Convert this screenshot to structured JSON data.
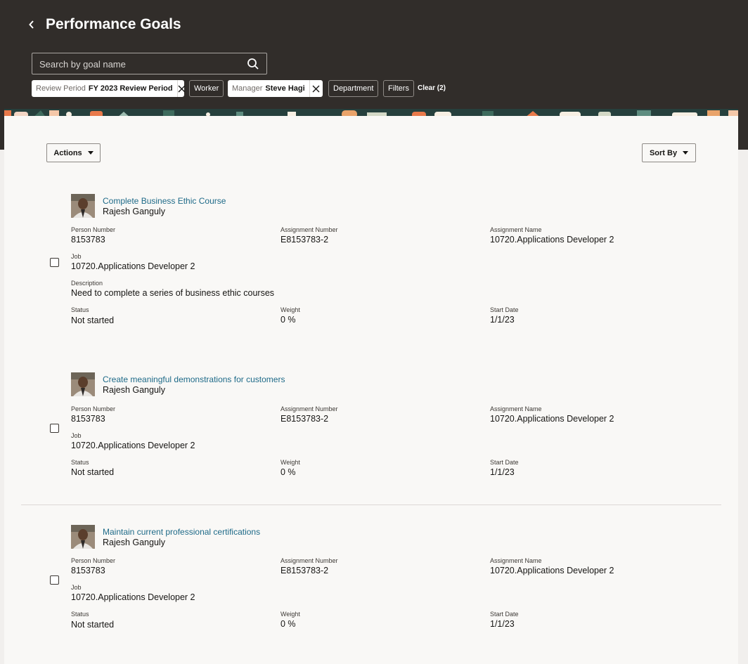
{
  "header": {
    "title": "Performance Goals",
    "back_icon": "chevron-left-icon"
  },
  "search": {
    "placeholder": "Search by goal name",
    "value": ""
  },
  "filters": {
    "review_period": {
      "label": "Review Period",
      "value": "FY 2023 Review Period"
    },
    "worker": {
      "label": "Worker"
    },
    "manager": {
      "label": "Manager",
      "value": "Steve Hagi"
    },
    "department": {
      "label": "Department"
    },
    "more": {
      "label": "Filters"
    },
    "clear": {
      "label": "Clear (2)"
    }
  },
  "toolbar": {
    "actions_label": "Actions",
    "sort_label": "Sort By"
  },
  "field_labels": {
    "person_number": "Person Number",
    "assignment_number": "Assignment Number",
    "assignment_name": "Assignment Name",
    "job": "Job",
    "description": "Description",
    "status": "Status",
    "weight": "Weight",
    "start_date": "Start Date"
  },
  "goals": [
    {
      "title": "Complete Business Ethic Course",
      "worker": "Rajesh Ganguly",
      "person_number": "8153783",
      "assignment_number": "E8153783-2",
      "assignment_name": "10720.Applications Developer 2",
      "job": "10720.Applications Developer 2",
      "description": "Need to complete a series of business ethic courses",
      "status": "Not started",
      "weight": "0 %",
      "start_date": "1/1/23"
    },
    {
      "title": "Create meaningful demonstrations for customers",
      "worker": "Rajesh Ganguly",
      "person_number": "8153783",
      "assignment_number": "E8153783-2",
      "assignment_name": "10720.Applications Developer 2",
      "job": "10720.Applications Developer 2",
      "status": "Not started",
      "weight": "0 %",
      "start_date": "1/1/23"
    },
    {
      "title": "Maintain current professional certifications",
      "worker": "Rajesh Ganguly",
      "person_number": "8153783",
      "assignment_number": "E8153783-2",
      "assignment_name": "10720.Applications Developer 2",
      "job": "10720.Applications Developer 2",
      "status": "Not started",
      "weight": "0 %",
      "start_date": "1/1/23"
    }
  ],
  "colors": {
    "header_bg": "#312d2a",
    "link": "#1e6a88",
    "card_bg": "#f9f8f6"
  }
}
